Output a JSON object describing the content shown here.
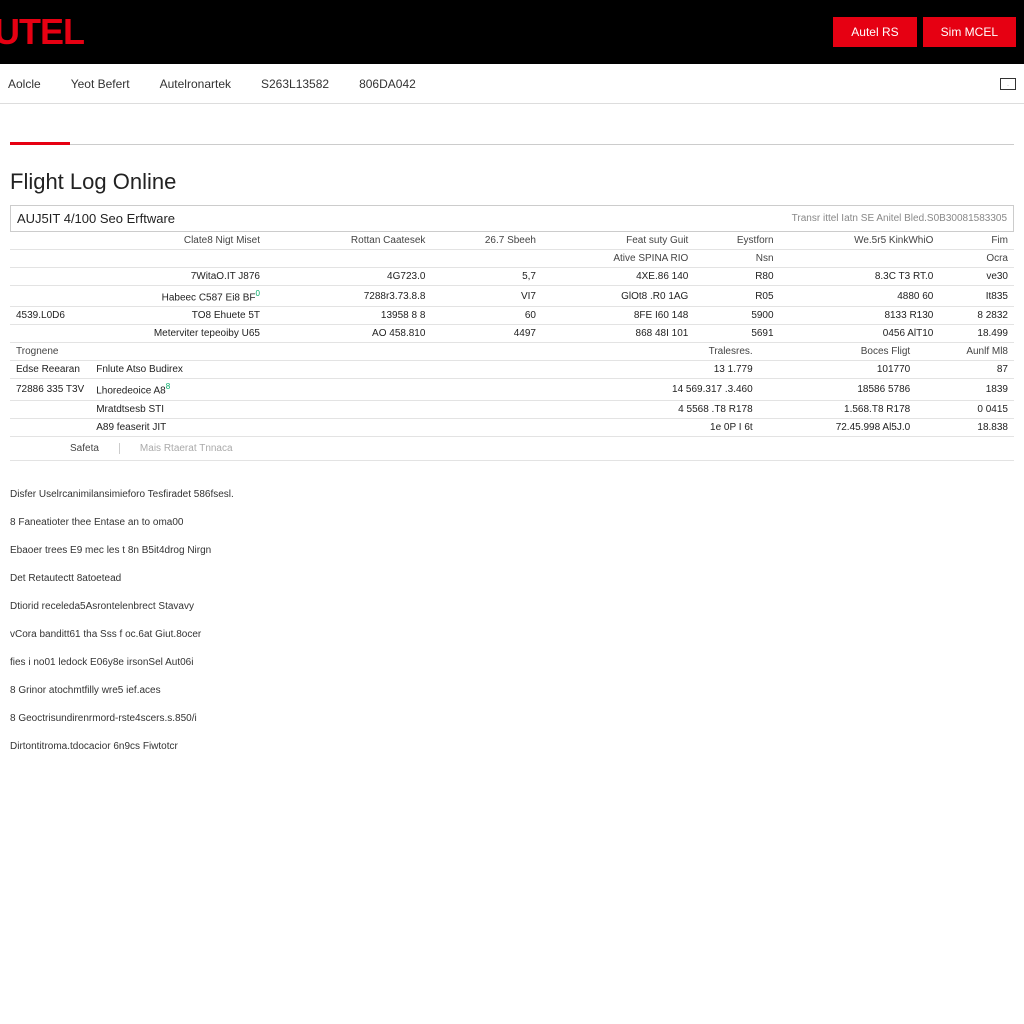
{
  "brand": "UTEL",
  "top_buttons": {
    "a": "Autel RS",
    "b": "Sim MCEL"
  },
  "nav": [
    "Aolcle",
    "Yeot Befert",
    "Autelronartek",
    "S263L13582",
    "806DA042"
  ],
  "page_title": "Flight Log Online",
  "subbar": {
    "left": "AUJ5IT 4/100 Seo Erftware",
    "right": "Transr ittel Iatn SE Anitel Bled.S0B30081583305"
  },
  "table1": {
    "headers": {
      "c1": "",
      "c2": "Clate8 Nigt Miset",
      "c3": "Rottan Caatesek",
      "c4": "26.7 Sbeeh",
      "c5": "Feat suty Guit",
      "c6": "Eystforn",
      "c7": "We.5r5 KinkWhiO",
      "c8": "Fim"
    },
    "subheaders": {
      "c5": "Ative SPINA RIO",
      "c6": "Nsn",
      "c8": "Ocra"
    },
    "rows": [
      {
        "c1": "",
        "c2": "7WitaO.IT J876",
        "c3": "4G723.0",
        "c4": "5,7",
        "c5": "4XE.86 140",
        "c6": "R80",
        "c7": "8.3C T3 RT.0",
        "c8": "ve30"
      },
      {
        "c1": "",
        "c2": "Habeec C587 Ei8 BF",
        "sup": "0",
        "c3": "7288r3.73.8.8",
        "c4": "VI7",
        "c5": "GlOt8 .R0 1AG",
        "c6": "R05",
        "c7": "4880 60",
        "c8": "It835"
      },
      {
        "c1": "4539.L0D6",
        "c2": "TO8 Ehuete 5T ",
        "c3": "13958 8 8",
        "c4": "60",
        "c5": "8FE I60 148",
        "c6": "5900",
        "c7": "8133 R130",
        "c8": "8 2832"
      },
      {
        "c1": "",
        "c2": "Meterviter tepeoiby U65",
        "c3": "AO 458.810",
        "c4": "4497",
        "c5": "868 48I 101",
        "c6": "5691",
        "c7": "0456 AlT10",
        "c8": "18.499"
      }
    ]
  },
  "table2": {
    "headers": {
      "c1": "Trognene",
      "c2": "",
      "c5": "Tralesres.",
      "c6": "Boces Fligt",
      "c7": "Aunlf Ml8"
    },
    "rows": [
      {
        "c1": "Edse Reearan",
        "c2": "Fnlute Atso Budirex",
        "c5": "13 1.779",
        "c6": "101770",
        "c7": "87"
      },
      {
        "c1": "72886 335 T3V",
        "c2": "Lhoredeoice A8",
        "sup": "8",
        "c5": "14 569.317 .3.460",
        "c6": "18586 5786",
        "c7": "1839"
      },
      {
        "c1": "",
        "c2": "Mratdtsesb STI",
        "c5": "4 5568 .T8 R178",
        "c6": "1.568.T8 R178",
        "c7": "0 0415"
      },
      {
        "c1": "",
        "c2": "A89 feaserit JIT",
        "c5": "1e 0P I 6t",
        "c6": "72.45.998 Al5J.0",
        "c7": "18.838"
      }
    ]
  },
  "bottom": {
    "col1": "Safeta",
    "col2": "Mais Rtaerat   Tnnaca"
  },
  "notes": [
    "Disfer Uselrcanimilansimieforo Tesfiradet 586fsesl.",
    "8 Faneatioter thee Entase an to oma00",
    "Ebaoer trees E9 mec les t 8n B5it4drog Nirgn",
    "Det Retautectt 8atoetead",
    "Dtiorid receleda5Asrontelenbrect Stavavy",
    "vCora banditt61 tha Sss f oc.6at Giut.8ocer",
    "fies i no01 ledock E06y8e irsonSel Aut06i",
    "8 Grinor atochmtfilly wre5 ief.aces",
    "8 Geoctrisundirenrmord-rste4scers.s.850/i",
    "Dirtontitroma.tdocacior 6n9cs Fiwtotcr"
  ]
}
